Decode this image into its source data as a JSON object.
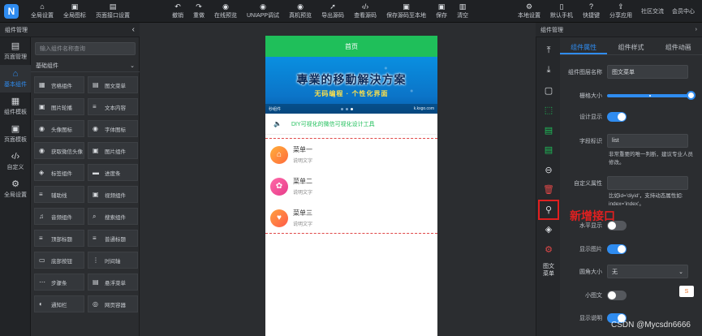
{
  "toolbar": {
    "left": [
      {
        "icon": "⌂",
        "label": "全局设置"
      },
      {
        "icon": "▣",
        "label": "全局图标"
      },
      {
        "icon": "▤",
        "label": "页面接口设置"
      }
    ],
    "middle": [
      {
        "icon": "↶",
        "label": "撤销"
      },
      {
        "icon": "↷",
        "label": "重做"
      },
      {
        "icon": "◉",
        "label": "在线预览"
      },
      {
        "icon": "◉",
        "label": "UNIAPP调试"
      },
      {
        "icon": "◉",
        "label": "真机预览"
      },
      {
        "icon": "➚",
        "label": "导出源码"
      },
      {
        "icon": "‹/›",
        "label": "查看源码"
      },
      {
        "icon": "▣",
        "label": "保存源码至本地"
      },
      {
        "icon": "▣",
        "label": "保存"
      },
      {
        "icon": "▥",
        "label": "清空"
      }
    ],
    "right_tools": [
      {
        "icon": "⚙",
        "label": "本地设置"
      },
      {
        "icon": "▯",
        "label": "默认手机"
      },
      {
        "icon": "?",
        "label": "快捷键"
      },
      {
        "icon": "⇪",
        "label": "分享应用"
      }
    ],
    "right_plain": [
      "社区交流",
      "会员中心"
    ]
  },
  "rail": [
    {
      "icon": "▤",
      "label": "页面管理",
      "active": false
    },
    {
      "icon": "⌂",
      "label": "基本组件",
      "active": true
    },
    {
      "icon": "▦",
      "label": "组件模板",
      "active": false
    },
    {
      "icon": "▣",
      "label": "页面模板",
      "active": false
    },
    {
      "icon": "‹/›",
      "label": "自定义",
      "active": false
    },
    {
      "icon": "⚙",
      "label": "全局设置",
      "active": false
    }
  ],
  "left_panel": {
    "title": "组件管理",
    "search_placeholder": "输入组件名称查询",
    "group": "基础组件",
    "components": [
      {
        "icon": "▦",
        "label": "宫格组件"
      },
      {
        "icon": "▤",
        "label": "图文菜单"
      },
      {
        "icon": "▣",
        "label": "图片轮播"
      },
      {
        "icon": "≡",
        "label": "文本内容"
      },
      {
        "icon": "◉",
        "label": "头像图标"
      },
      {
        "icon": "◉",
        "label": "字体图标"
      },
      {
        "icon": "◉",
        "label": "获取微信头像"
      },
      {
        "icon": "▣",
        "label": "图片组件"
      },
      {
        "icon": "◈",
        "label": "标签组件"
      },
      {
        "icon": "▬",
        "label": "进度条"
      },
      {
        "icon": "≡",
        "label": "辅助线"
      },
      {
        "icon": "▣",
        "label": "视频组件"
      },
      {
        "icon": "♫",
        "label": "音频组件"
      },
      {
        "icon": "⌕",
        "label": "搜索组件"
      },
      {
        "icon": "≡",
        "label": "顶部标题"
      },
      {
        "icon": "≡",
        "label": "普通标题"
      },
      {
        "icon": "▭",
        "label": "底部按钮"
      },
      {
        "icon": "⋮",
        "label": "时间轴"
      },
      {
        "icon": "⋯",
        "label": "步骤条"
      },
      {
        "icon": "▤",
        "label": "悬浮菜单"
      },
      {
        "icon": "◐",
        "label": "通知栏"
      },
      {
        "icon": "◎",
        "label": "网页容器"
      }
    ]
  },
  "phone": {
    "header": "首页",
    "banner_title": "專業的移動解決方案",
    "banner_sub": "无码编程 · 个性化界面",
    "banner_foot_left": "秒组件",
    "banner_foot_right": "k.kxgo.com",
    "notice": "DIY可视化的微信可视化设计工具",
    "menu": [
      {
        "icon": "⌂",
        "title": "菜单一",
        "desc": "说明文字",
        "color": "c1"
      },
      {
        "icon": "✿",
        "title": "菜单二",
        "desc": "说明文字",
        "color": "c2"
      },
      {
        "icon": "♥",
        "title": "菜单三",
        "desc": "说明文字",
        "color": "c3"
      }
    ]
  },
  "right_tools": [
    {
      "icon": "⤒",
      "tone": ""
    },
    {
      "icon": "⤓",
      "tone": ""
    },
    {
      "icon": "▢",
      "tone": ""
    },
    {
      "icon": "⬚",
      "tone": "green"
    },
    {
      "icon": "▤",
      "tone": "green"
    },
    {
      "icon": "▤",
      "tone": "green"
    },
    {
      "icon": "⊖",
      "tone": ""
    },
    {
      "icon": "🗑",
      "tone": "red"
    },
    {
      "icon": "⚲",
      "tone": "",
      "highlight": true
    },
    {
      "icon": "◈",
      "tone": ""
    },
    {
      "icon": "⚙",
      "tone": "red"
    }
  ],
  "right_tools_text": "图文\n菜单",
  "annotation": "新增接口",
  "right_panel": {
    "title": "组件管理",
    "tabs": [
      "组件属性",
      "组件样式",
      "组件动画"
    ],
    "fields": {
      "layer_name_label": "组件图层名称",
      "layer_name_value": "图文菜单",
      "grid_size_label": "栅格大小",
      "design_show_label": "设计显示",
      "field_id_label": "字段标识",
      "field_id_value": "list",
      "field_id_hint": "非常重要的唯一判断，建议专业人员修改。",
      "custom_attr_label": "自定义属性",
      "custom_attr_hint": "比如id='diyid'，支持动态属性如: index='index'。",
      "horizontal_label": "水平显示",
      "show_image_label": "显示图片",
      "radius_label": "圆角大小",
      "radius_value": "无",
      "small_icon_label": "小图文",
      "show_desc_label": "显示说明"
    }
  },
  "watermark": "CSDN @Mycsdn6666",
  "side_badge": "S"
}
